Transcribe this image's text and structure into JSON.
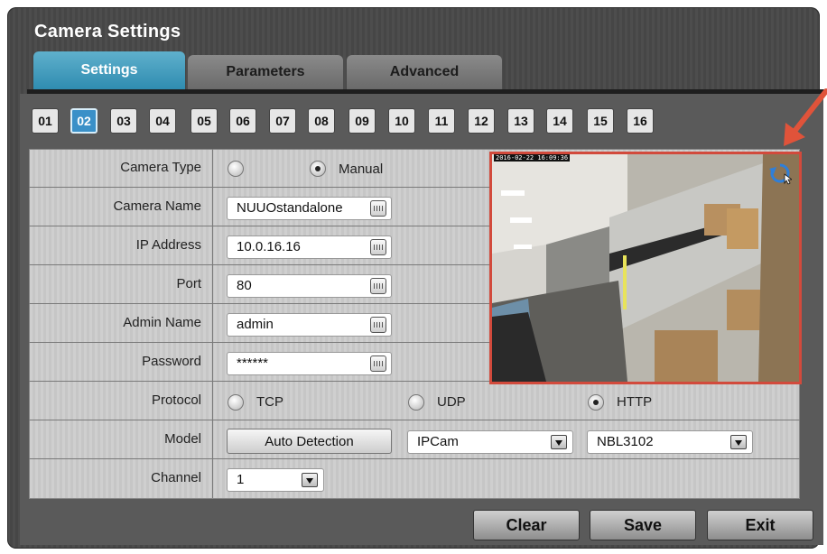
{
  "window": {
    "title": "Camera Settings"
  },
  "tabs": [
    {
      "label": "Settings",
      "active": true
    },
    {
      "label": "Parameters",
      "active": false
    },
    {
      "label": "Advanced",
      "active": false
    }
  ],
  "channels": [
    "01",
    "02",
    "03",
    "04",
    "05",
    "06",
    "07",
    "08",
    "09",
    "10",
    "11",
    "12",
    "13",
    "14",
    "15",
    "16"
  ],
  "selected_channel": "02",
  "form": {
    "camera_type": {
      "label": "Camera Type",
      "options": [
        "",
        "Manual"
      ],
      "selected": "Manual"
    },
    "camera_name": {
      "label": "Camera Name",
      "value": "NUUOstandalone"
    },
    "ip_address": {
      "label": "IP Address",
      "value": "10.0.16.16"
    },
    "port": {
      "label": "Port",
      "value": "80"
    },
    "admin_name": {
      "label": "Admin Name",
      "value": "admin"
    },
    "password": {
      "label": "Password",
      "value": "******"
    },
    "protocol": {
      "label": "Protocol",
      "options": [
        "TCP",
        "UDP",
        "HTTP"
      ],
      "selected": "HTTP"
    },
    "model": {
      "label": "Model",
      "auto_detection": "Auto Detection",
      "brand": "IPCam",
      "model_value": "NBL3102"
    },
    "channel": {
      "label": "Channel",
      "value": "1"
    }
  },
  "preview": {
    "timestamp": "2016-02-22 16:09:36",
    "refresh_icon": "refresh-icon"
  },
  "actions": {
    "clear": "Clear",
    "save": "Save",
    "exit": "Exit"
  },
  "colors": {
    "accent": "#2f8cb0",
    "highlight_border": "#d24a3c",
    "arrow": "#e0533a"
  }
}
